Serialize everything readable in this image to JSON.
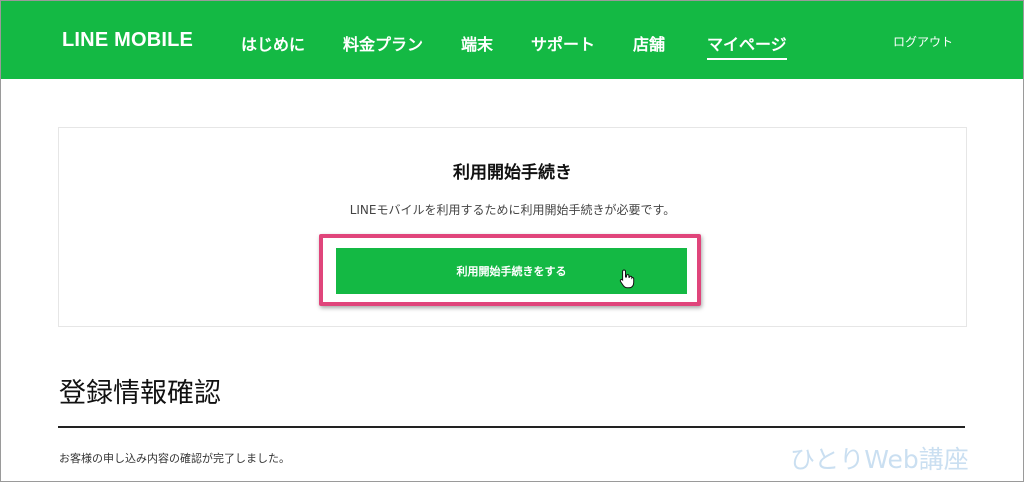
{
  "header": {
    "logo": "LINE MOBILE",
    "nav": [
      {
        "label": "はじめに"
      },
      {
        "label": "料金プラン"
      },
      {
        "label": "端末"
      },
      {
        "label": "サポート"
      },
      {
        "label": "店舗"
      },
      {
        "label": "マイページ",
        "active": true
      }
    ],
    "logout": "ログアウト"
  },
  "card": {
    "title": "利用開始手続き",
    "description": "LINEモバイルを利用するために利用開始手続きが必要です。",
    "button_label": "利用開始手続きをする"
  },
  "section": {
    "title": "登録情報確認",
    "text": "お客様の申し込み内容の確認が完了しました。"
  },
  "watermark": "ひとりWeb講座",
  "colors": {
    "brand_green": "#14b944",
    "highlight_pink": "#e0457b"
  }
}
